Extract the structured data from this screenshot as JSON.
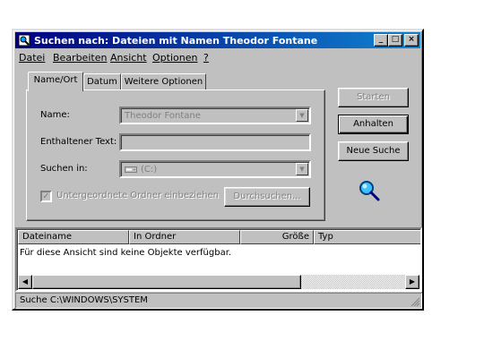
{
  "window": {
    "title": "Suchen nach: Dateien mit Namen Theodor Fontane",
    "controls": {
      "minimize": "_",
      "maximize": "□",
      "close": "×"
    }
  },
  "menu": [
    {
      "label": "Datei"
    },
    {
      "label": "Bearbeiten"
    },
    {
      "label": "Ansicht"
    },
    {
      "label": "Optionen"
    },
    {
      "label": "?"
    }
  ],
  "tabs": [
    {
      "label": "Name/Ort",
      "active": true
    },
    {
      "label": "Datum",
      "active": false
    },
    {
      "label": "Weitere Optionen",
      "active": false
    }
  ],
  "form": {
    "name_label": "Name:",
    "name_value": "Theodor Fontane",
    "text_label": "Enthaltener Text:",
    "text_value": "",
    "search_in_label": "Suchen in:",
    "search_in_value": "(C:)",
    "subfolders_label": "Untergeordnete Ordner einbeziehen",
    "subfolders_checked": true,
    "browse_label": "Durchsuchen..."
  },
  "buttons": {
    "start": "Starten",
    "stop": "Anhalten",
    "new_search": "Neue Suche"
  },
  "results": {
    "columns": [
      "Dateiname",
      "In Ordner",
      "Größe",
      "Typ"
    ],
    "empty_message": "Für diese Ansicht sind keine Objekte verfügbar."
  },
  "status": {
    "text": "Suche C:\\WINDOWS\\SYSTEM"
  },
  "colors": {
    "face": "#c0c0c0",
    "title_start": "#000080",
    "title_end": "#1084d0",
    "disabled_text": "#808080"
  },
  "icons": {
    "app": "search-window-icon",
    "magnifier": "magnifier-icon",
    "drive": "hard-drive-icon"
  }
}
